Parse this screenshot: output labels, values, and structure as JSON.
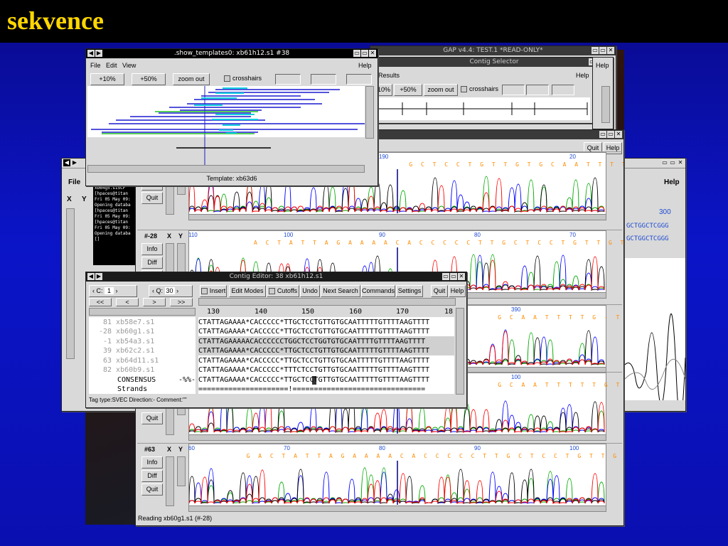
{
  "slide_title": "sekvence",
  "gap_main": {
    "title": "GAP v4.4: TEST.1    *READ-ONLY*"
  },
  "contig_selector": {
    "title": "Contig Selector",
    "menu_results": "Results",
    "help": "Help",
    "zoom_10": "10%",
    "zoom_50": "+50%",
    "zoom_out": "zoom out",
    "crosshairs": "crosshairs"
  },
  "templates": {
    "title": ".show_templates0: xb61h12.s1 #38",
    "menu": {
      "file": "File",
      "edit": "Edit",
      "view": "View",
      "help": "Help"
    },
    "zoom_10": "+10%",
    "zoom_50": "+50%",
    "zoom_out": "zoom out",
    "crosshairs": "crosshairs",
    "status": "Template: xb63d6"
  },
  "back_left": {
    "menu_file": "File",
    "x": "X",
    "y": "Y",
    "log_lines": [
      "xb64g5.s1SCF",
      "[hpaces@titan",
      "Fri 05 May 09:",
      "",
      "Opening databa",
      "[hpaces@titan",
      "Fri 05 May 09:",
      "[hpaces@titan",
      "Fri 05 May 09:",
      "",
      "Opening databa",
      "[]"
    ]
  },
  "back_right": {
    "help": "Help",
    "ruler": "300",
    "seq_lines": [
      "GCTGGCTCGGG",
      "GCTGGCTCGGG"
    ]
  },
  "trace": {
    "quit": "Quit",
    "help": "Help",
    "status": "Reading xb60g1.s1 (#-28)",
    "panels": [
      {
        "id": "",
        "x": "",
        "y": "",
        "info": "Info",
        "diff": "Diff",
        "quit": "Quit",
        "ticks": [
          "180",
          "190",
          "20"
        ],
        "bases": "G C T C C T G T T G T G C A A T T T T T G T T T T A A"
      },
      {
        "id": "#-28",
        "x": "X",
        "y": "Y",
        "info": "Info",
        "diff": "Diff",
        "quit": "Quit",
        "ticks": [
          "110",
          "100",
          "90",
          "80",
          "70"
        ],
        "bases": "A C T A T T A G A A A A C A C C C C C T T G C T C C T G T T G T G C A A T T T T T G T T T T A A"
      },
      {
        "id": "",
        "x": "",
        "y": "",
        "info": "",
        "diff": "",
        "quit": "",
        "ticks": [
          "390"
        ],
        "bases": "G C A A T T T T G - T T T A A"
      },
      {
        "id": "",
        "x": "",
        "y": "",
        "info": "",
        "diff": "",
        "quit": "Quit",
        "ticks": [
          "100"
        ],
        "bases": "G C A A T T T T T G T T T A A"
      },
      {
        "id": "#63",
        "x": "X",
        "y": "Y",
        "info": "Info",
        "diff": "Diff",
        "quit": "Quit",
        "ticks": [
          "60",
          "70",
          "80",
          "90",
          "100"
        ],
        "bases": "G A C T A T T A G A A A A C A C C C C C T T G C T C C T G T T G T G C A A T T T T T G T T T T A A"
      }
    ]
  },
  "contig_editor": {
    "title": "Contig Editor:  38 xb61h12.s1",
    "c_label": "C:",
    "c_value": "1",
    "q_label": "Q:",
    "q_value": "30",
    "insert": "Insert",
    "edit_modes": "Edit Modes",
    "cutoffs": "Cutoffs",
    "undo": "Undo",
    "next_search": "Next Search",
    "commands": "Commands",
    "settings": "Settings",
    "quit": "Quit",
    "help": "Help",
    "nav": [
      "<<",
      "<",
      ">",
      ">>"
    ],
    "ruler": [
      "130",
      "140",
      "150",
      "160",
      "170",
      "18"
    ],
    "names": [
      "81 xb58e7.s1",
      "-28 xb60g1.s1",
      "-1 xb54a3.s1",
      "39 xb62c2.s1",
      "63 xb64d11.s1",
      "82 xb60b9.s1",
      "CONSENSUS",
      "Strands"
    ],
    "consensus_flag": "-%%-",
    "sequences": [
      "CTATTAGAAAA*CACCCCC*TTGCTCCTGTTGTGCAATTTTTGTTTTAAGTTTT",
      "CTATTAGAAAA*CACCCCC*TTGCTCCTGTTGTGCAATTTTTGTTTTAAGTTTT",
      "CTATTAGAAAAACACCCCCCTGGCTCCTGGTGTGCAATTTTGTTTTAAGTTTT",
      "CTATTAGAAAA*CACCCCC*TTGCTCCTGTTGTGCAATTTTTGTTTTAAGTTTT",
      "CTATTAGAAAA*CACCCCC*TTGCTCCTGTTGTGCAATTTTTGTTTTAAGTTTT",
      "CTATTAGAAAA*CACCCCC*TTTCTCCTGTTGTGCAATTTTTGTTTTAAGTTTT",
      "CTATTAGAAAA*CACCCCC*TTGCTCCTGTTGTGCAATTTTTGTTTTAAGTTTT",
      "=====================!===============================",
      "Tag type:SVEC   Direction:-   Comment:\"\""
    ],
    "tag_status": "Tag type:SVEC   Direction:-   Comment:\"\""
  },
  "colors": {
    "title": "#ffd700",
    "base_call": "#ff8c00",
    "ruler": "#1e4bd2",
    "trace_a": "#00aa00",
    "trace_c": "#0000ff",
    "trace_g": "#000000",
    "trace_t": "#ff0000"
  }
}
